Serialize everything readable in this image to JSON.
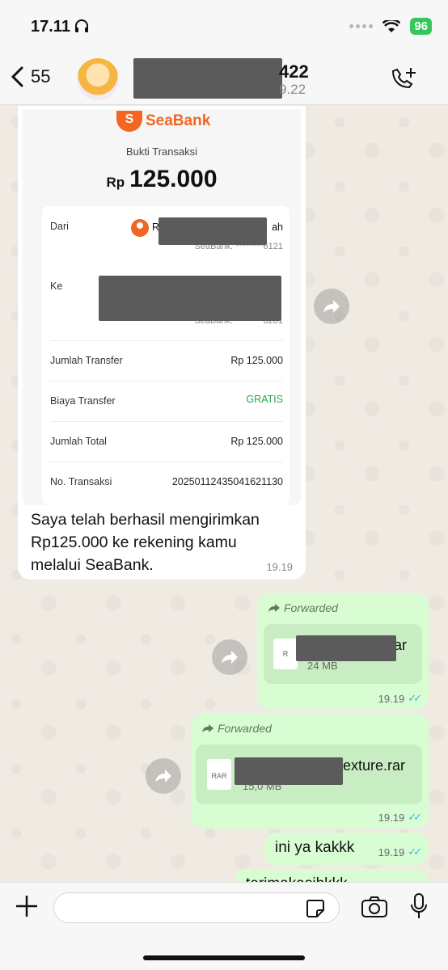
{
  "status": {
    "time": "17.11",
    "battery": "96"
  },
  "header": {
    "back_count": "55",
    "contact_name_suffix": "422",
    "contact_sub_suffix": "9.22"
  },
  "receipt": {
    "brand": "SeaBank",
    "title": "Bukti Transaksi",
    "currency": "Rp",
    "amount": "125.000",
    "rows": {
      "from_label": "Dari",
      "sender_initial": "Ra",
      "sender_tail": "ah",
      "from_bank": "SeaBank: ********6121",
      "to_label": "Ke",
      "to_bank_left": "SeaBank:",
      "to_bank_right": "0281",
      "transfer_label": "Jumlah Transfer",
      "transfer_value": "Rp 125.000",
      "fee_label": "Biaya Transfer",
      "fee_value": "GRATIS",
      "total_label": "Jumlah Total",
      "total_value": "Rp 125.000",
      "txn_label": "No. Transaksi",
      "txn_value": "20250112435041621130"
    }
  },
  "messages": {
    "incoming_text": "Saya telah berhasil mengirimkan Rp125.000 ke rekening kamu melalui SeaBank.",
    "incoming_time": "19.19",
    "fwd1": {
      "label": "Forwarded",
      "file_suffix": "rar",
      "file_size": "24 MB",
      "icon_text": "R",
      "time": "19.19"
    },
    "fwd2": {
      "label": "Forwarded",
      "file_suffix": "exture.rar",
      "file_size": "15,0 MB",
      "icon_text": "RAR",
      "time": "19.19"
    },
    "text_out": {
      "text": "ini ya kakkk",
      "time": "19.19"
    },
    "partial_out": "terimakasihkkk"
  },
  "input": {
    "placeholder": ""
  },
  "colors": {
    "accent": "#34c759",
    "seabank": "#f26522",
    "out_bubble": "#d9fdd3",
    "read_ticks": "#34b7f1"
  }
}
